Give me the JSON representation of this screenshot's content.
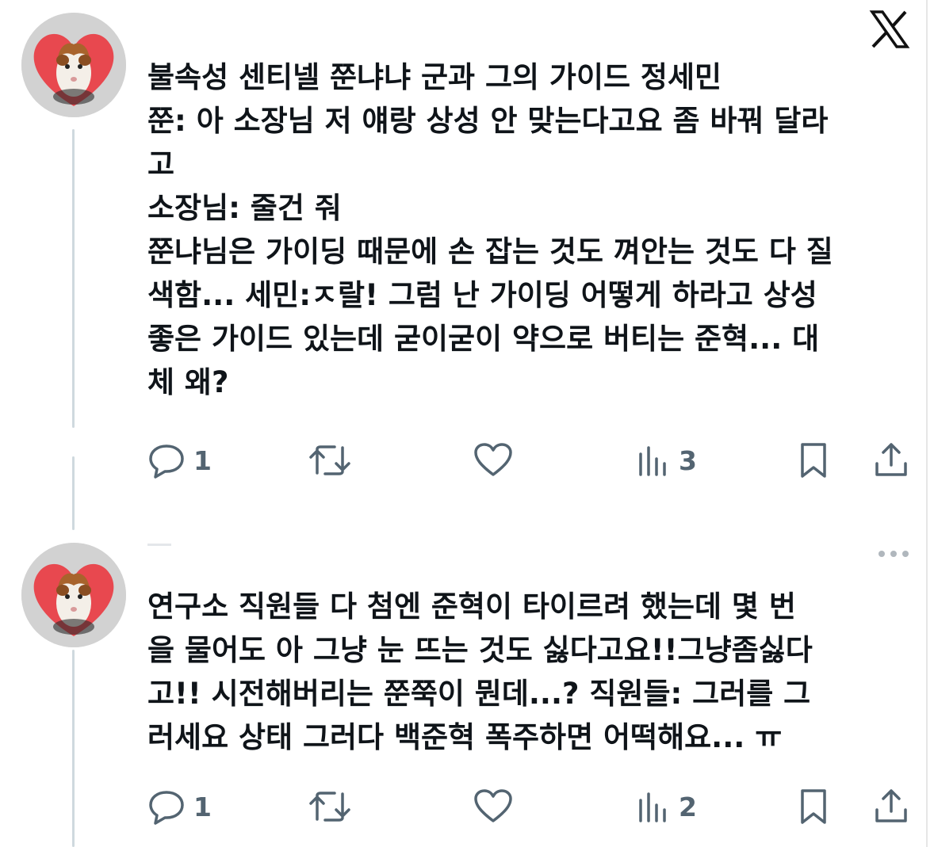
{
  "brand": {
    "icon": "x-logo-icon"
  },
  "tweets": [
    {
      "avatar_icon": "guinea-pig-avatar",
      "text": "불속성 센티넬 쭌냐냐 군과 그의 가이드 정세민\n쭌: 아 소장님 저 얘랑 상성 안 맞는다고요 좀 바꿔 달라\n고\n소장님: 줄건 줘\n쭌냐님은 가이딩 때문에 손 잡는 것도 껴안는 것도 다 질\n색함... 세민:ㅈ랄! 그럼 난 가이딩 어떻게 하라고 상성\n좋은 가이드 있는데 굳이굳이 약으로 버티는 준혁... 대\n체 왜?",
      "actions": {
        "reply_count": "1",
        "retweet_count": "",
        "like_count": "",
        "views_count": "3"
      }
    },
    {
      "avatar_icon": "guinea-pig-avatar",
      "text": "연구소 직원들 다 첨엔 준혁이 타이르려 했는데 몇 번\n을 물어도 아 그냥 눈 뜨는 것도 싫다고요!!그냥좀싫다\n고!! 시전해버리는 쭌쭉이 뭔데...? 직원들: 그러를 그\n러세요 상태 그러다 백준혁 폭주하면 어떡해요... ㅠ",
      "actions": {
        "reply_count": "1",
        "retweet_count": "",
        "like_count": "",
        "views_count": "2"
      }
    }
  ],
  "colors": {
    "text": "#0f1419",
    "muted": "#536471",
    "thread_line": "#cfd9de",
    "avatar_heart": "#e8484f"
  }
}
